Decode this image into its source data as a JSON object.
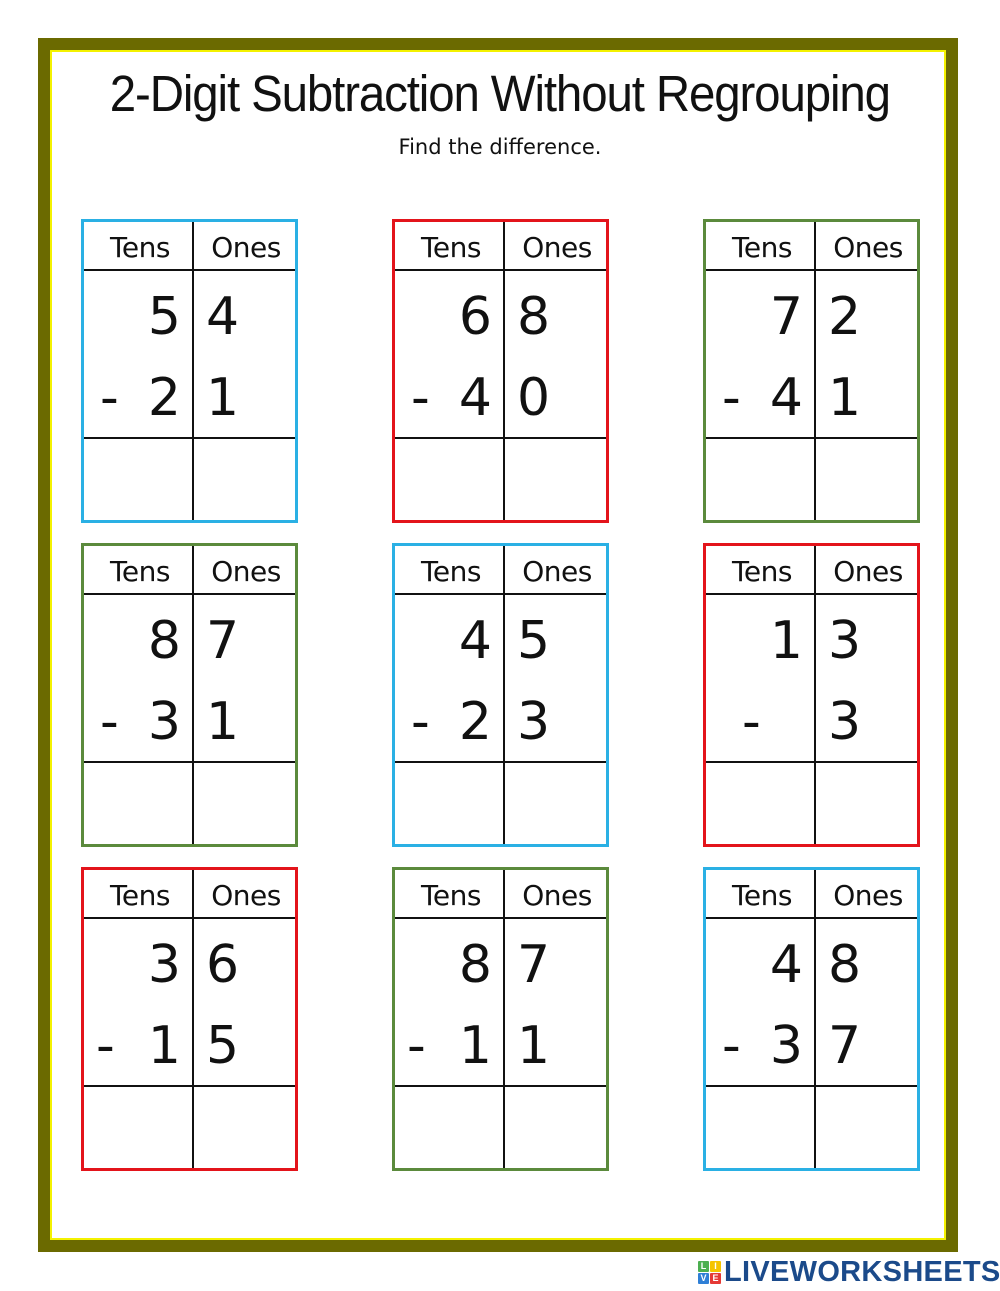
{
  "worksheet": {
    "title": "2-Digit Subtraction Without Regrouping",
    "instruction": "Find the difference.",
    "column_headers": {
      "tens": "Tens",
      "ones": "Ones"
    },
    "operator": "-",
    "colors": {
      "frame_olive": "#6b6a00",
      "frame_yellow": "#f4f200",
      "card_blue": "#2ab0e4",
      "card_red": "#e3141b",
      "card_green": "#5b8a3c"
    },
    "problems": [
      {
        "color": "#2ab0e4",
        "top_tens": "5",
        "top_ones": "4",
        "bottom_tens": "2",
        "bottom_ones": "1",
        "answer_tens": "",
        "answer_ones": ""
      },
      {
        "color": "#e3141b",
        "top_tens": "6",
        "top_ones": "8",
        "bottom_tens": "4",
        "bottom_ones": "0",
        "answer_tens": "",
        "answer_ones": ""
      },
      {
        "color": "#5b8a3c",
        "top_tens": "7",
        "top_ones": "2",
        "bottom_tens": "4",
        "bottom_ones": "1",
        "answer_tens": "",
        "answer_ones": ""
      },
      {
        "color": "#5b8a3c",
        "top_tens": "8",
        "top_ones": "7",
        "bottom_tens": "3",
        "bottom_ones": "1",
        "answer_tens": "",
        "answer_ones": ""
      },
      {
        "color": "#2ab0e4",
        "top_tens": "4",
        "top_ones": "5",
        "bottom_tens": "2",
        "bottom_ones": "3",
        "answer_tens": "",
        "answer_ones": ""
      },
      {
        "color": "#e3141b",
        "top_tens": "1",
        "top_ones": "3",
        "bottom_tens": "",
        "bottom_ones": "3",
        "answer_tens": "",
        "answer_ones": ""
      },
      {
        "color": "#e3141b",
        "top_tens": "3",
        "top_ones": "6",
        "bottom_tens": "1",
        "bottom_ones": "5",
        "answer_tens": "",
        "answer_ones": ""
      },
      {
        "color": "#5b8a3c",
        "top_tens": "8",
        "top_ones": "7",
        "bottom_tens": "1",
        "bottom_ones": "1",
        "answer_tens": "",
        "answer_ones": ""
      },
      {
        "color": "#2ab0e4",
        "top_tens": "4",
        "top_ones": "8",
        "bottom_tens": "3",
        "bottom_ones": "7",
        "answer_tens": "",
        "answer_ones": ""
      }
    ]
  },
  "branding": {
    "logo_blocks": [
      {
        "letter": "L",
        "color": "#4caf50"
      },
      {
        "letter": "I",
        "color": "#f5c400"
      },
      {
        "letter": "V",
        "color": "#2f7fd6"
      },
      {
        "letter": "E",
        "color": "#e53935"
      }
    ],
    "logo_text": "LIVEWORKSHEETS"
  }
}
